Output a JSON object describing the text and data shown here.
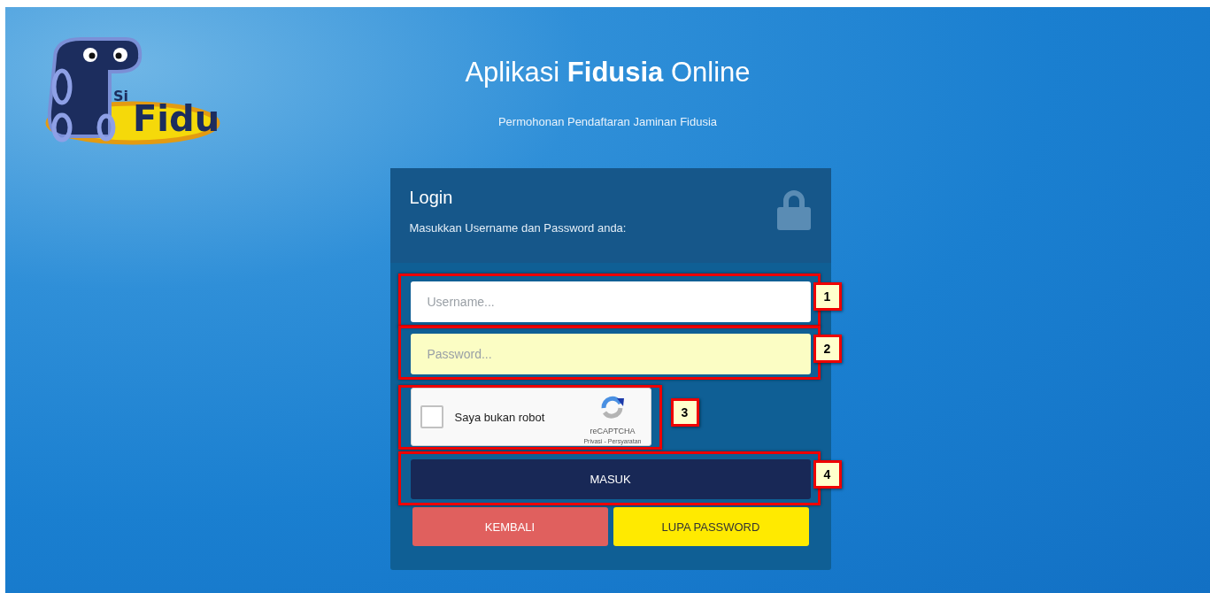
{
  "logo": {
    "small_text": "Si",
    "large_text": "Fidu"
  },
  "header": {
    "title": "Aplikasi **Fidusia** Online",
    "subtitle": "Permohonan Pendaftaran Jaminan Fidusia"
  },
  "login": {
    "title": "Login",
    "instruction": "Masukkan Username dan Password anda:",
    "username": {
      "placeholder": "Username...",
      "autofilled": false,
      "callout": "1"
    },
    "password": {
      "placeholder": "Password...",
      "autofilled": true,
      "callout": "2"
    },
    "captcha": {
      "checked": false,
      "label": "Saya bukan robot",
      "brand": "reCAPTCHA",
      "links": [
        "Privasi",
        "Persyaratan"
      ],
      "separator": "-",
      "callout": "3"
    },
    "submit": {
      "label": "MASUK",
      "callout": "4"
    },
    "buttons": [
      {
        "label": "KEMBALI",
        "kind": "back"
      },
      {
        "label": "LUPA PASSWORD",
        "kind": "forgot"
      }
    ]
  }
}
